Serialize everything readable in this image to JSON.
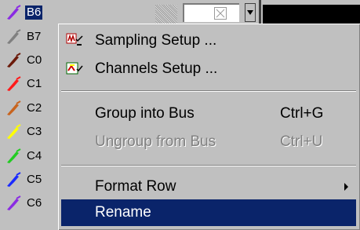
{
  "channels": [
    {
      "label": "B6",
      "color": "#8a2be2",
      "selected": true
    },
    {
      "label": "B7",
      "color": "#808080"
    },
    {
      "label": "C0",
      "color": "#6b1a0a"
    },
    {
      "label": "C1",
      "color": "#ff1a1a"
    },
    {
      "label": "C2",
      "color": "#c8641e"
    },
    {
      "label": "C3",
      "color": "#ffff00"
    },
    {
      "label": "C4",
      "color": "#22cc22"
    },
    {
      "label": "C5",
      "color": "#1a2aff"
    },
    {
      "label": "C6",
      "color": "#8a2be2"
    }
  ],
  "menu": {
    "sampling_setup": {
      "label": "Sampling Setup ...",
      "icon": "sampling-setup-icon"
    },
    "channels_setup": {
      "label": "Channels Setup ...",
      "icon": "channels-setup-icon"
    },
    "group_into_bus": {
      "label": "Group into Bus",
      "shortcut": "Ctrl+G"
    },
    "ungroup_from_bus": {
      "label": "Ungroup from Bus",
      "shortcut": "Ctrl+U",
      "disabled": true
    },
    "format_row": {
      "label": "Format Row",
      "has_submenu": true
    },
    "rename": {
      "label": "Rename",
      "highlighted": true
    }
  },
  "colors": {
    "menu_bg": "#c0c0c0",
    "highlight": "#0a246a",
    "disabled_text": "#808080"
  }
}
